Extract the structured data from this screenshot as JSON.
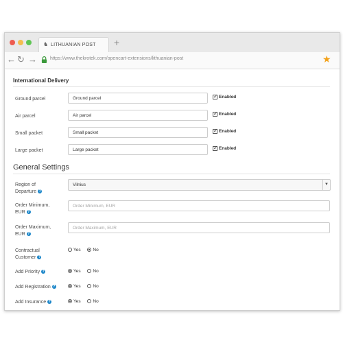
{
  "browser": {
    "tab_title": "LITHUANIAN POST",
    "tab_icon": "post-horn-icon",
    "url": "https://www.thekrotek.com/opencart-extensions/lithuanian-post",
    "accent_star": "#f3a21a"
  },
  "international": {
    "title": "International Delivery",
    "rows": [
      {
        "label": "Ground parcel",
        "value": "Ground parcel",
        "check": "Enabled"
      },
      {
        "label": "Air parcel",
        "value": "Air parcel",
        "check": "Enabled"
      },
      {
        "label": "Small packet",
        "value": "Small packet",
        "check": "Enabled"
      },
      {
        "label": "Large packet",
        "value": "Large packet",
        "check": "Enabled"
      }
    ]
  },
  "general": {
    "title": "General Settings",
    "region": {
      "label_1": "Region of",
      "label_2": "Departure",
      "value": "Vilnius"
    },
    "order_min": {
      "label_1": "Order Minimum,",
      "label_2": "EUR",
      "placeholder": "Order Minimum, EUR"
    },
    "order_max": {
      "label_1": "Order Maximum,",
      "label_2": "EUR",
      "placeholder": "Order Maximum, EUR"
    },
    "contractual": {
      "label_1": "Contractual",
      "label_2": "Customer",
      "yes": "Yes",
      "no": "No",
      "selected": "No"
    },
    "priority": {
      "label": "Add Priority",
      "yes": "Yes",
      "no": "No",
      "selected": "Yes"
    },
    "registration": {
      "label": "Add Registration",
      "yes": "Yes",
      "no": "No",
      "selected": "Yes"
    },
    "insurance": {
      "label": "Add Insurance",
      "yes": "Yes",
      "no": "No",
      "selected": "Yes"
    }
  }
}
